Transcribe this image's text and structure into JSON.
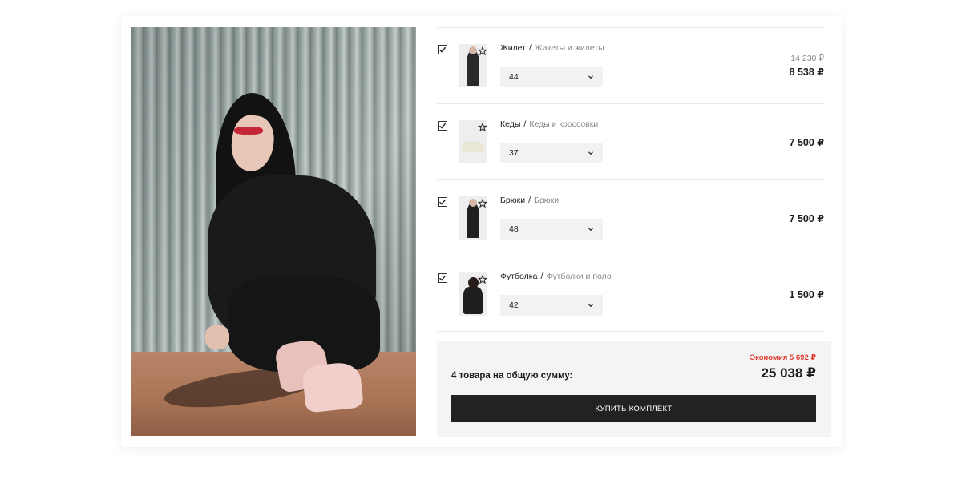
{
  "items": [
    {
      "name": "Жилет",
      "separator": "/",
      "category": "Жакеты и жилеты",
      "size": "44",
      "price_old": "14 230 ₽",
      "price": "8 538 ₽",
      "checked": true,
      "thumb_type": "person-light"
    },
    {
      "name": "Кеды",
      "separator": "/",
      "category": "Кеды и кроссовки",
      "size": "37",
      "price_old": null,
      "price": "7 500 ₽",
      "checked": true,
      "thumb_type": "sneaker"
    },
    {
      "name": "Брюки",
      "separator": "/",
      "category": "Брюки",
      "size": "48",
      "price_old": null,
      "price": "7 500 ₽",
      "checked": true,
      "thumb_type": "person-dark"
    },
    {
      "name": "Футболка",
      "separator": "/",
      "category": "Футболки и поло",
      "size": "42",
      "price_old": null,
      "price": "1 500 ₽",
      "checked": true,
      "thumb_type": "person-tee"
    }
  ],
  "summary": {
    "economy": "Экономия 5 692 ₽",
    "label": "4 товара на общую сумму:",
    "total": "25 038 ₽",
    "buy_label": "КУПИТЬ КОМПЛЕКТ"
  },
  "colors": {
    "accent_dark": "#222222",
    "economy_red": "#e0382f",
    "muted_text": "#8a8a8a",
    "select_bg": "#f2f2f2",
    "summary_bg": "#f4f4f4"
  },
  "icons": {
    "checkbox": "checkmark-icon",
    "favorite": "star-icon",
    "select": "chevron-down-icon"
  }
}
